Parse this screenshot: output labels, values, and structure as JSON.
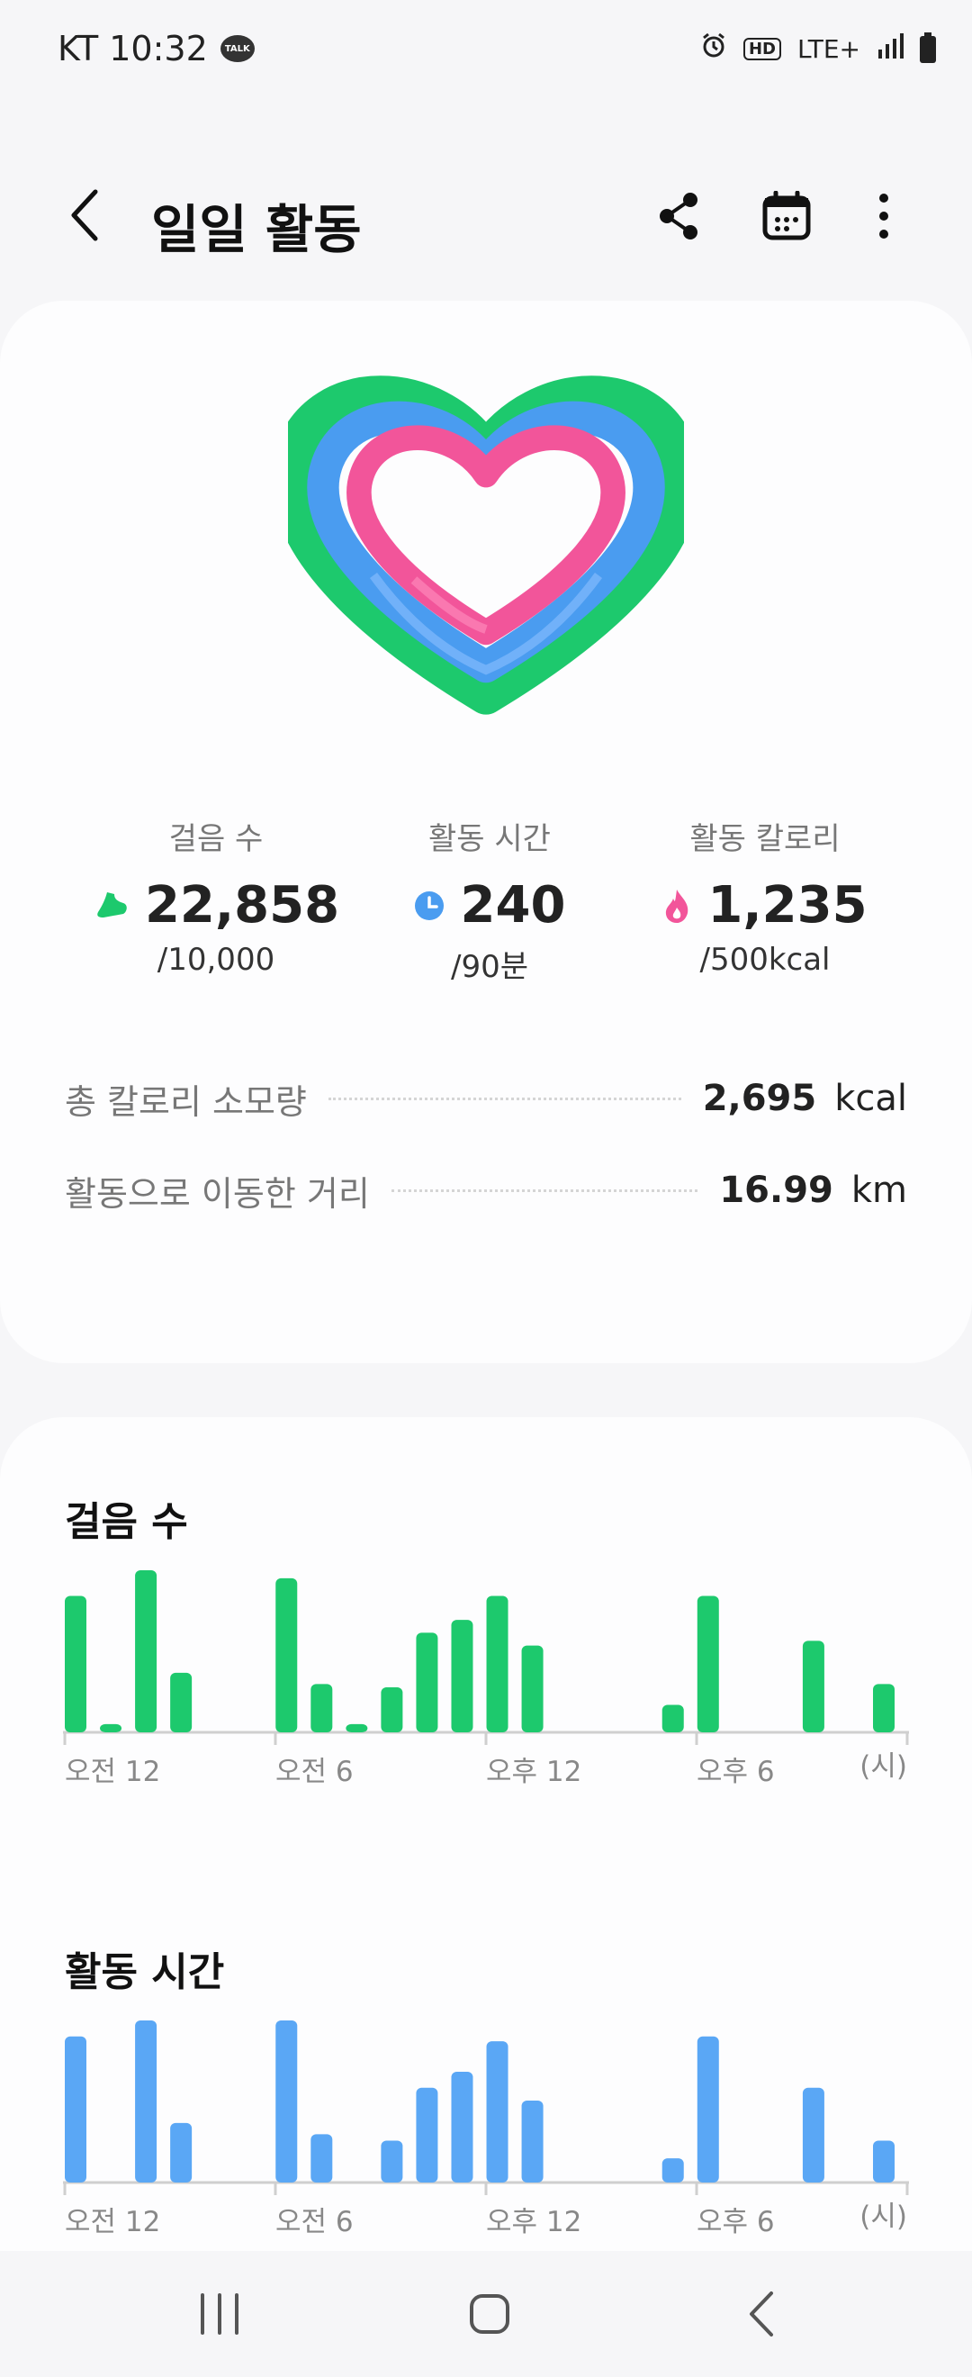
{
  "status_bar": {
    "carrier_time": "KT 10:32",
    "talk_label": "TALK",
    "hd_label": "HD",
    "network_label": "LTE+"
  },
  "header": {
    "title": "일일 활동"
  },
  "summary": {
    "metrics": [
      {
        "label": "걸음 수",
        "value": "22,858",
        "goal": "/10,000",
        "icon": "shoe-icon",
        "color": "#1dc96d"
      },
      {
        "label": "활동 시간",
        "value": "240",
        "goal": "/90분",
        "icon": "clock-icon",
        "color": "#4a9cf0"
      },
      {
        "label": "활동 칼로리",
        "value": "1,235",
        "goal": "/500kcal",
        "icon": "flame-icon",
        "color": "#f2559a"
      }
    ],
    "details": [
      {
        "label": "총 칼로리 소모량",
        "value": "2,695",
        "unit": "kcal"
      },
      {
        "label": "활동으로 이동한 거리",
        "value": "16.99",
        "unit": "km"
      }
    ]
  },
  "colors": {
    "steps": "#1dc96d",
    "active_time": "#5aa7f5",
    "calories": "#f2559a"
  },
  "chart_data": [
    {
      "type": "bar",
      "title": "걸음 수",
      "x_tick_labels": [
        "오전 12",
        "오전 6",
        "오후 12",
        "오후 6"
      ],
      "x_unit_label": "(시)",
      "categories": [
        "0",
        "1",
        "2",
        "3",
        "4",
        "5",
        "6",
        "7",
        "8",
        "9",
        "10",
        "11",
        "12",
        "13",
        "14",
        "15",
        "16",
        "17",
        "18",
        "19",
        "20",
        "21",
        "22",
        "23"
      ],
      "values": [
        0.84,
        0.04,
        1.0,
        0.36,
        0,
        0,
        0.95,
        0.29,
        0.04,
        0.27,
        0.61,
        0.69,
        0.84,
        0.53,
        0,
        0,
        0,
        0.16,
        0.84,
        0,
        0,
        0.56,
        0,
        0.29
      ],
      "color": "#1dc96d"
    },
    {
      "type": "bar",
      "title": "활동 시간",
      "x_tick_labels": [
        "오전 12",
        "오전 6",
        "오후 12",
        "오후 6"
      ],
      "x_unit_label": "(시)",
      "categories": [
        "0",
        "1",
        "2",
        "3",
        "4",
        "5",
        "6",
        "7",
        "8",
        "9",
        "10",
        "11",
        "12",
        "13",
        "14",
        "15",
        "16",
        "17",
        "18",
        "19",
        "20",
        "21",
        "22",
        "23"
      ],
      "values": [
        0.9,
        0,
        1.0,
        0.36,
        0,
        0,
        1.0,
        0.29,
        0,
        0.25,
        0.58,
        0.68,
        0.87,
        0.5,
        0,
        0,
        0,
        0.14,
        0.9,
        0,
        0,
        0.58,
        0,
        0.25
      ],
      "color": "#5aa7f5"
    }
  ]
}
